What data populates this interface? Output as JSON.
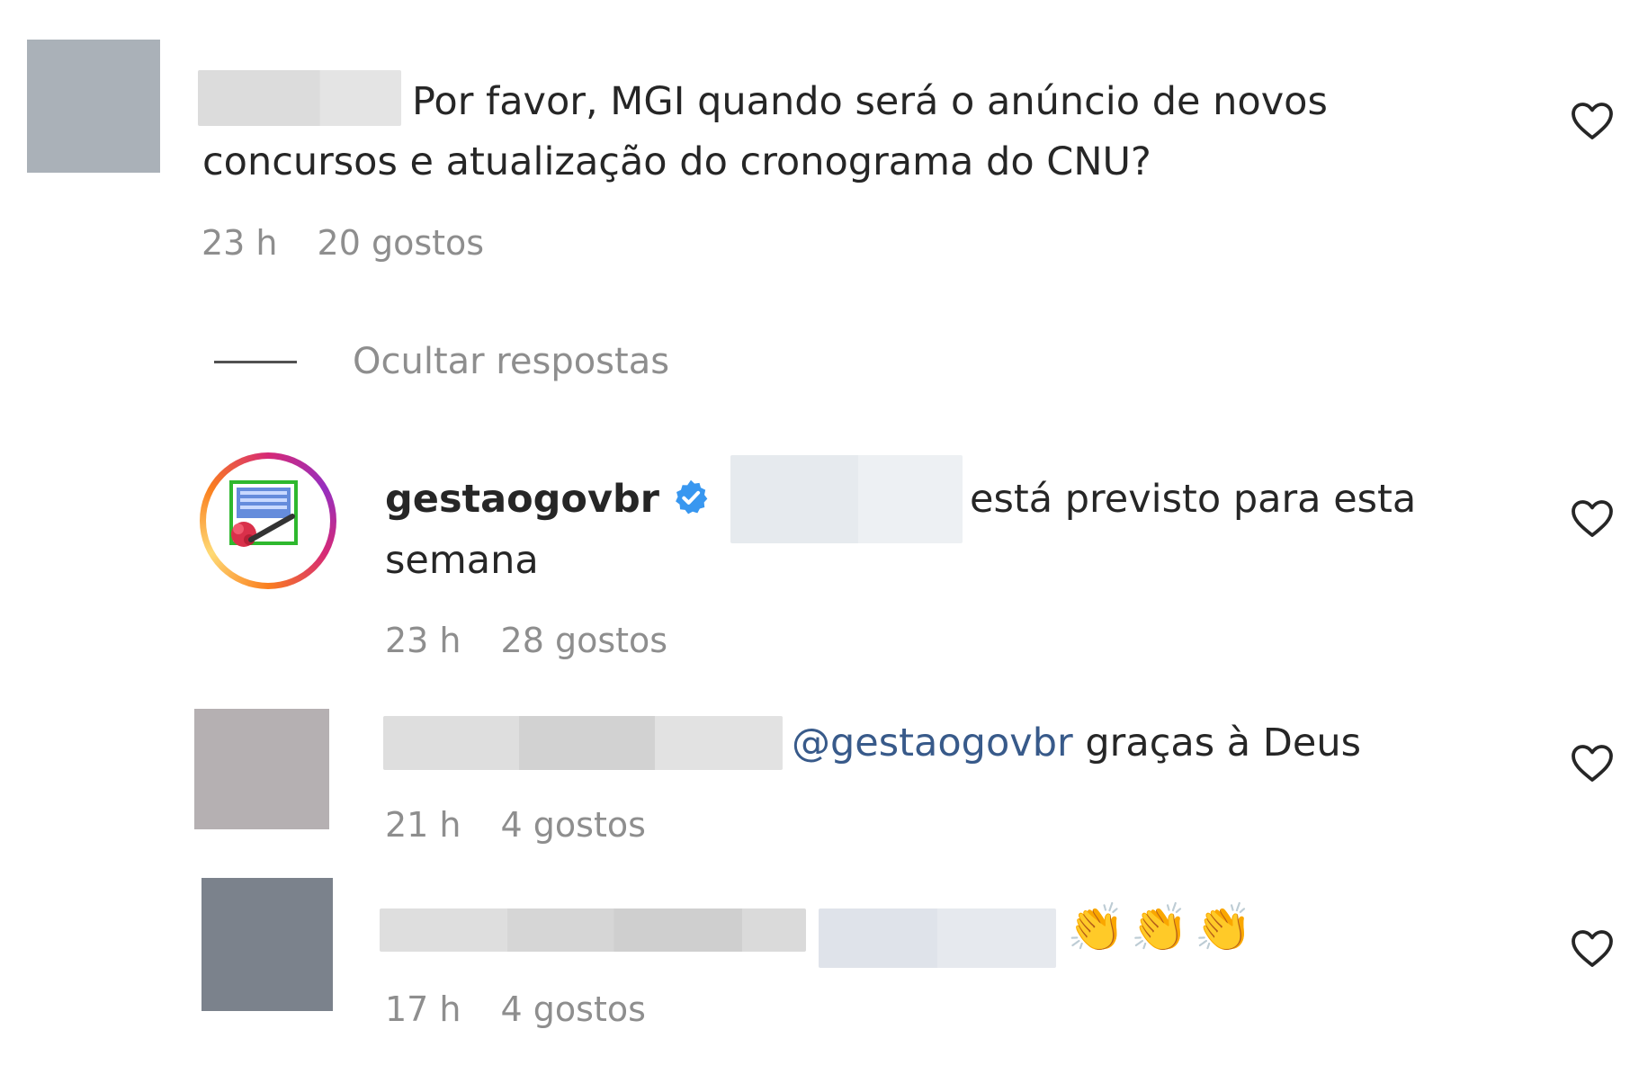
{
  "comments": [
    {
      "text": "Por favor, MGI quando será o anúncio de novos",
      "text_line2": "concursos e atualização do cronograma do CNU?",
      "time": "23 h",
      "likes": "20 gostos"
    }
  ],
  "hide_replies_label": "Ocultar respostas",
  "replies": [
    {
      "username": "gestaogovbr",
      "verified": true,
      "text": "está previsto para esta",
      "text_line2": "semana",
      "time": "23 h",
      "likes": "28 gostos"
    },
    {
      "mention": "@gestaogovbr",
      "text": "graças à Deus",
      "time": "21 h",
      "likes": "4 gostos"
    },
    {
      "text": "👏👏👏",
      "time": "17 h",
      "likes": "4 gostos"
    }
  ],
  "colors": {
    "meta_text": "#8e8e8e",
    "mention": "#385a8a",
    "verified_badge": "#3897f0",
    "heart_outline": "#262626"
  },
  "icons": {
    "like": "heart-outline-icon",
    "verified": "verified-badge-icon"
  }
}
